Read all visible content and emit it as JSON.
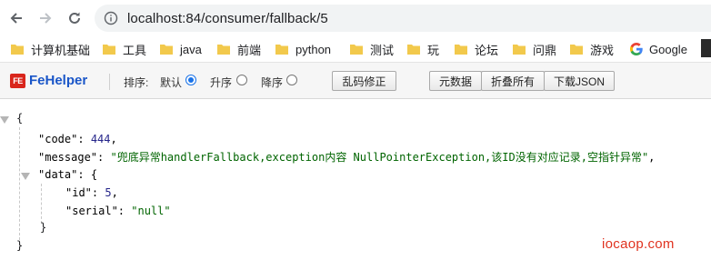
{
  "browser": {
    "url": "localhost:84/consumer/fallback/5"
  },
  "bookmarks": [
    {
      "label": "计算机基础",
      "icon": "folder-icon"
    },
    {
      "label": "工具",
      "icon": "folder-icon"
    },
    {
      "label": "java",
      "icon": "folder-icon"
    },
    {
      "label": "前端",
      "icon": "folder-icon"
    },
    {
      "label": "python",
      "icon": "folder-icon"
    },
    {
      "label": "测试",
      "icon": "folder-icon"
    },
    {
      "label": "玩",
      "icon": "folder-icon"
    },
    {
      "label": "论坛",
      "icon": "folder-icon"
    },
    {
      "label": "问鼎",
      "icon": "folder-icon"
    },
    {
      "label": "游戏",
      "icon": "folder-icon"
    },
    {
      "label": "Google",
      "icon": "google-icon"
    }
  ],
  "fehelper": {
    "title": "FeHelper",
    "logo_text": "FE",
    "sort_label": "排序:",
    "options": [
      "默认",
      "升序",
      "降序"
    ],
    "selected": "默认",
    "buttons": [
      "乱码修正",
      "元数据",
      "折叠所有",
      "下载JSON"
    ]
  },
  "json": {
    "open": "{",
    "close": "}",
    "code_key": "\"code\"",
    "code_value": "444",
    "message_key": "\"message\"",
    "message_value": "\"兜底异常handlerFallback,exception内容  NullPointerException,该ID没有对应记录,空指针异常\"",
    "data_key": "\"data\"",
    "data_open": "{",
    "data_close": "}",
    "id_key": "\"id\"",
    "id_value": "5",
    "serial_key": "\"serial\"",
    "serial_value": "\"null\""
  },
  "watermark": "iocaop.com",
  "colors": {
    "fehelper_blue": "#1a56c8",
    "radio_blue": "#1a73e8",
    "number": "#25258a",
    "string": "#006400",
    "watermark": "#e0321f",
    "folder": "#f2c94c"
  }
}
